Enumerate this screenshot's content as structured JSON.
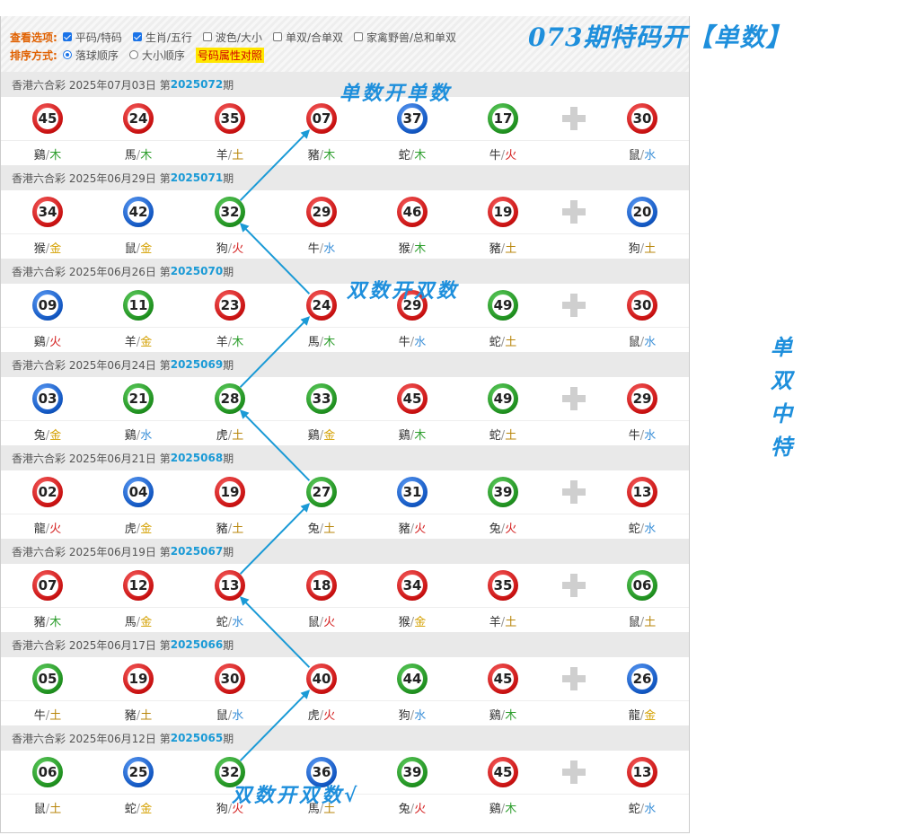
{
  "toolbar": {
    "view_label": "查看选项:",
    "view_options": [
      {
        "label": "平码/特码",
        "checked": true
      },
      {
        "label": "生肖/五行",
        "checked": true
      },
      {
        "label": "波色/大小",
        "checked": false
      },
      {
        "label": "单双/合单双",
        "checked": false
      },
      {
        "label": "家禽野兽/总和单双",
        "checked": false
      }
    ],
    "sort_label": "排序方式:",
    "sort_options": [
      {
        "label": "落球顺序",
        "selected": true
      },
      {
        "label": "大小顺序",
        "selected": false
      }
    ],
    "attr_link": "号码属性对照"
  },
  "overlay": {
    "title": "073期特码开【单数】",
    "note1": "单数开单数",
    "note2": "双数开双数",
    "note3": "双数开双数√",
    "side": [
      "单",
      "双",
      "中",
      "特"
    ]
  },
  "colors": {
    "accent": "#1a9ad6",
    "overlay": "#1e8fdc",
    "red_ball": "#c81010",
    "blue_ball": "#1055c0",
    "green_ball": "#1e8f1e",
    "metal": "#d4a000",
    "wood": "#2e9e2e",
    "water": "#3a8fd8",
    "fire": "#d42020",
    "earth": "#b8860b"
  },
  "draws": [
    {
      "prefix": "香港六合彩 2025年07月03日 第",
      "issue": "2025072",
      "suffix": "期",
      "balls": [
        {
          "num": "45",
          "color": "red",
          "zodiac": "鷄",
          "element": "木"
        },
        {
          "num": "24",
          "color": "red",
          "zodiac": "馬",
          "element": "木"
        },
        {
          "num": "35",
          "color": "red",
          "zodiac": "羊",
          "element": "土"
        },
        {
          "num": "07",
          "color": "red",
          "zodiac": "豬",
          "element": "木"
        },
        {
          "num": "37",
          "color": "blue",
          "zodiac": "蛇",
          "element": "木"
        },
        {
          "num": "17",
          "color": "green",
          "zodiac": "牛",
          "element": "火"
        },
        {
          "num": "30",
          "color": "red",
          "zodiac": "鼠",
          "element": "水"
        }
      ]
    },
    {
      "prefix": "香港六合彩 2025年06月29日 第",
      "issue": "2025071",
      "suffix": "期",
      "balls": [
        {
          "num": "34",
          "color": "red",
          "zodiac": "猴",
          "element": "金"
        },
        {
          "num": "42",
          "color": "blue",
          "zodiac": "鼠",
          "element": "金"
        },
        {
          "num": "32",
          "color": "green",
          "zodiac": "狗",
          "element": "火"
        },
        {
          "num": "29",
          "color": "red",
          "zodiac": "牛",
          "element": "水"
        },
        {
          "num": "46",
          "color": "red",
          "zodiac": "猴",
          "element": "木"
        },
        {
          "num": "19",
          "color": "red",
          "zodiac": "豬",
          "element": "土"
        },
        {
          "num": "20",
          "color": "blue",
          "zodiac": "狗",
          "element": "土"
        }
      ]
    },
    {
      "prefix": "香港六合彩 2025年06月26日 第",
      "issue": "2025070",
      "suffix": "期",
      "balls": [
        {
          "num": "09",
          "color": "blue",
          "zodiac": "鷄",
          "element": "火"
        },
        {
          "num": "11",
          "color": "green",
          "zodiac": "羊",
          "element": "金"
        },
        {
          "num": "23",
          "color": "red",
          "zodiac": "羊",
          "element": "木"
        },
        {
          "num": "24",
          "color": "red",
          "zodiac": "馬",
          "element": "木"
        },
        {
          "num": "29",
          "color": "red",
          "zodiac": "牛",
          "element": "水"
        },
        {
          "num": "49",
          "color": "green",
          "zodiac": "蛇",
          "element": "土"
        },
        {
          "num": "30",
          "color": "red",
          "zodiac": "鼠",
          "element": "水"
        }
      ]
    },
    {
      "prefix": "香港六合彩 2025年06月24日 第",
      "issue": "2025069",
      "suffix": "期",
      "balls": [
        {
          "num": "03",
          "color": "blue",
          "zodiac": "兔",
          "element": "金"
        },
        {
          "num": "21",
          "color": "green",
          "zodiac": "鷄",
          "element": "水"
        },
        {
          "num": "28",
          "color": "green",
          "zodiac": "虎",
          "element": "土"
        },
        {
          "num": "33",
          "color": "green",
          "zodiac": "鷄",
          "element": "金"
        },
        {
          "num": "45",
          "color": "red",
          "zodiac": "鷄",
          "element": "木"
        },
        {
          "num": "49",
          "color": "green",
          "zodiac": "蛇",
          "element": "土"
        },
        {
          "num": "29",
          "color": "red",
          "zodiac": "牛",
          "element": "水"
        }
      ]
    },
    {
      "prefix": "香港六合彩 2025年06月21日 第",
      "issue": "2025068",
      "suffix": "期",
      "balls": [
        {
          "num": "02",
          "color": "red",
          "zodiac": "龍",
          "element": "火"
        },
        {
          "num": "04",
          "color": "blue",
          "zodiac": "虎",
          "element": "金"
        },
        {
          "num": "19",
          "color": "red",
          "zodiac": "豬",
          "element": "土"
        },
        {
          "num": "27",
          "color": "green",
          "zodiac": "兔",
          "element": "土"
        },
        {
          "num": "31",
          "color": "blue",
          "zodiac": "豬",
          "element": "火"
        },
        {
          "num": "39",
          "color": "green",
          "zodiac": "兔",
          "element": "火"
        },
        {
          "num": "13",
          "color": "red",
          "zodiac": "蛇",
          "element": "水"
        }
      ]
    },
    {
      "prefix": "香港六合彩 2025年06月19日 第",
      "issue": "2025067",
      "suffix": "期",
      "balls": [
        {
          "num": "07",
          "color": "red",
          "zodiac": "豬",
          "element": "木"
        },
        {
          "num": "12",
          "color": "red",
          "zodiac": "馬",
          "element": "金"
        },
        {
          "num": "13",
          "color": "red",
          "zodiac": "蛇",
          "element": "水"
        },
        {
          "num": "18",
          "color": "red",
          "zodiac": "鼠",
          "element": "火"
        },
        {
          "num": "34",
          "color": "red",
          "zodiac": "猴",
          "element": "金"
        },
        {
          "num": "35",
          "color": "red",
          "zodiac": "羊",
          "element": "土"
        },
        {
          "num": "06",
          "color": "green",
          "zodiac": "鼠",
          "element": "土"
        }
      ]
    },
    {
      "prefix": "香港六合彩 2025年06月17日 第",
      "issue": "2025066",
      "suffix": "期",
      "balls": [
        {
          "num": "05",
          "color": "green",
          "zodiac": "牛",
          "element": "土"
        },
        {
          "num": "19",
          "color": "red",
          "zodiac": "豬",
          "element": "土"
        },
        {
          "num": "30",
          "color": "red",
          "zodiac": "鼠",
          "element": "水"
        },
        {
          "num": "40",
          "color": "red",
          "zodiac": "虎",
          "element": "火"
        },
        {
          "num": "44",
          "color": "green",
          "zodiac": "狗",
          "element": "水"
        },
        {
          "num": "45",
          "color": "red",
          "zodiac": "鷄",
          "element": "木"
        },
        {
          "num": "26",
          "color": "blue",
          "zodiac": "龍",
          "element": "金"
        }
      ]
    },
    {
      "prefix": "香港六合彩 2025年06月12日 第",
      "issue": "2025065",
      "suffix": "期",
      "balls": [
        {
          "num": "06",
          "color": "green",
          "zodiac": "鼠",
          "element": "土"
        },
        {
          "num": "25",
          "color": "blue",
          "zodiac": "蛇",
          "element": "金"
        },
        {
          "num": "32",
          "color": "green",
          "zodiac": "狗",
          "element": "火"
        },
        {
          "num": "36",
          "color": "blue",
          "zodiac": "馬",
          "element": "土"
        },
        {
          "num": "39",
          "color": "green",
          "zodiac": "兔",
          "element": "火"
        },
        {
          "num": "45",
          "color": "red",
          "zodiac": "鷄",
          "element": "木"
        },
        {
          "num": "13",
          "color": "red",
          "zodiac": "蛇",
          "element": "水"
        }
      ]
    }
  ]
}
